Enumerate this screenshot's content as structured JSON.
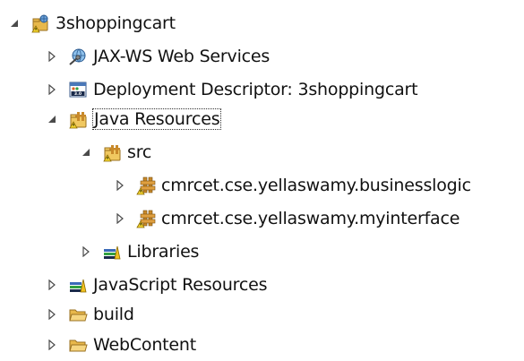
{
  "tree": {
    "items": [
      {
        "label": "3shoppingcart",
        "expanded": true,
        "icon": "web-project-icon"
      },
      {
        "label": "JAX-WS Web Services",
        "expanded": false,
        "icon": "web-services-icon"
      },
      {
        "label": "Deployment Descriptor: 3shoppingcart",
        "expanded": false,
        "icon": "deployment-descriptor-icon"
      },
      {
        "label": "Java Resources",
        "expanded": true,
        "icon": "java-resources-icon",
        "focused": true
      },
      {
        "label": "src",
        "expanded": true,
        "icon": "source-folder-icon"
      },
      {
        "label": "cmrcet.cse.yellaswamy.businesslogic",
        "expanded": false,
        "icon": "package-icon"
      },
      {
        "label": "cmrcet.cse.yellaswamy.myinterface",
        "expanded": false,
        "icon": "package-icon"
      },
      {
        "label": "Libraries",
        "expanded": false,
        "icon": "libraries-icon"
      },
      {
        "label": "JavaScript Resources",
        "expanded": false,
        "icon": "javascript-resources-icon"
      },
      {
        "label": "build",
        "expanded": false,
        "icon": "folder-icon"
      },
      {
        "label": "WebContent",
        "expanded": false,
        "icon": "folder-icon"
      }
    ]
  },
  "colors": {
    "toggle": "#4a4a4a",
    "folder": "#e8b84a",
    "package": "#c8892a",
    "focus_outline": "#333333"
  }
}
